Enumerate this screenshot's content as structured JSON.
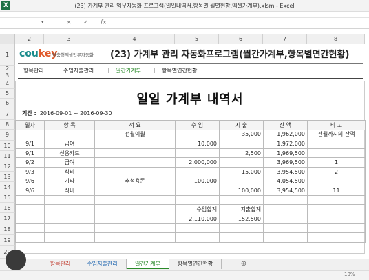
{
  "window": {
    "title": "(23) 가계부 관리 업무자동화 프로그램(일일내역서,항목별 월별현황,엑셀가계부).xlsm - Excel",
    "app_icon": "X"
  },
  "formula_bar": {
    "fx": "fx",
    "cancel": "×",
    "enter": "✓"
  },
  "columns": [
    "2",
    "3",
    "4",
    "5",
    "6",
    "7",
    "8"
  ],
  "row_numbers": [
    "1",
    "2",
    "3",
    "4",
    "5",
    "6",
    "7",
    "8",
    "9",
    "10",
    "11",
    "12",
    "13",
    "14",
    "15",
    "16",
    "17",
    "18",
    "19",
    "20"
  ],
  "header": {
    "logo_main": "cou",
    "logo_accent": "key",
    "logo_sub": "맞춤형엑셀업무자동화",
    "title": "(23) 가계부 관리 자동화프로그램(월간가계부,항목별연간현황)"
  },
  "nav": {
    "items": [
      "항목관리",
      "수입지출관리",
      "일간가계부",
      "항목별연간현황"
    ],
    "separator": "|",
    "active": "일간가계부"
  },
  "doc": {
    "title": "일일 가계부 내역서",
    "period_label": "기간 :",
    "period_value": "2016-09-01 ~ 2016-09-30"
  },
  "table": {
    "headers": [
      "일자",
      "항 목",
      "적 요",
      "수 입",
      "지 출",
      "잔 액",
      "비 고"
    ],
    "rows": [
      [
        "",
        "",
        "전월이월",
        "",
        "35,000",
        "1,962,000",
        "전월까지의 잔액"
      ],
      [
        "9/1",
        "급여",
        "",
        "10,000",
        "",
        "1,972,000",
        ""
      ],
      [
        "9/1",
        "신용카드",
        "",
        "",
        "2,500",
        "1,969,500",
        ""
      ],
      [
        "9/2",
        "급여",
        "",
        "2,000,000",
        "",
        "3,969,500",
        "1"
      ],
      [
        "9/3",
        "식비",
        "",
        "",
        "15,000",
        "3,954,500",
        "2"
      ],
      [
        "9/6",
        "기타",
        "추석용돈",
        "100,000",
        "",
        "4,054,500",
        ""
      ],
      [
        "9/6",
        "식비",
        "",
        "",
        "100,000",
        "3,954,500",
        "11"
      ],
      [
        "",
        "",
        "",
        "",
        "",
        "",
        ""
      ],
      [
        "",
        "",
        "",
        "수입합계",
        "지출합계",
        "",
        ""
      ],
      [
        "",
        "",
        "",
        "2,110,000",
        "152,500",
        "",
        ""
      ],
      [
        "",
        "",
        "",
        "",
        "",
        "",
        ""
      ],
      [
        "",
        "",
        "",
        "",
        "",
        "",
        ""
      ]
    ]
  },
  "sheet_tabs": [
    "항목관리",
    "수입지출관리",
    "일간가계부",
    "항목별연간현황"
  ],
  "active_sheet": "일간가계부",
  "add_sheet": "⊕",
  "status": {
    "zoom": "10%"
  },
  "colors": {
    "accent_green": "#2a8a2a",
    "logo_teal": "#1a8c8c",
    "logo_orange": "#e0592a",
    "excel_green": "#1e7145"
  }
}
